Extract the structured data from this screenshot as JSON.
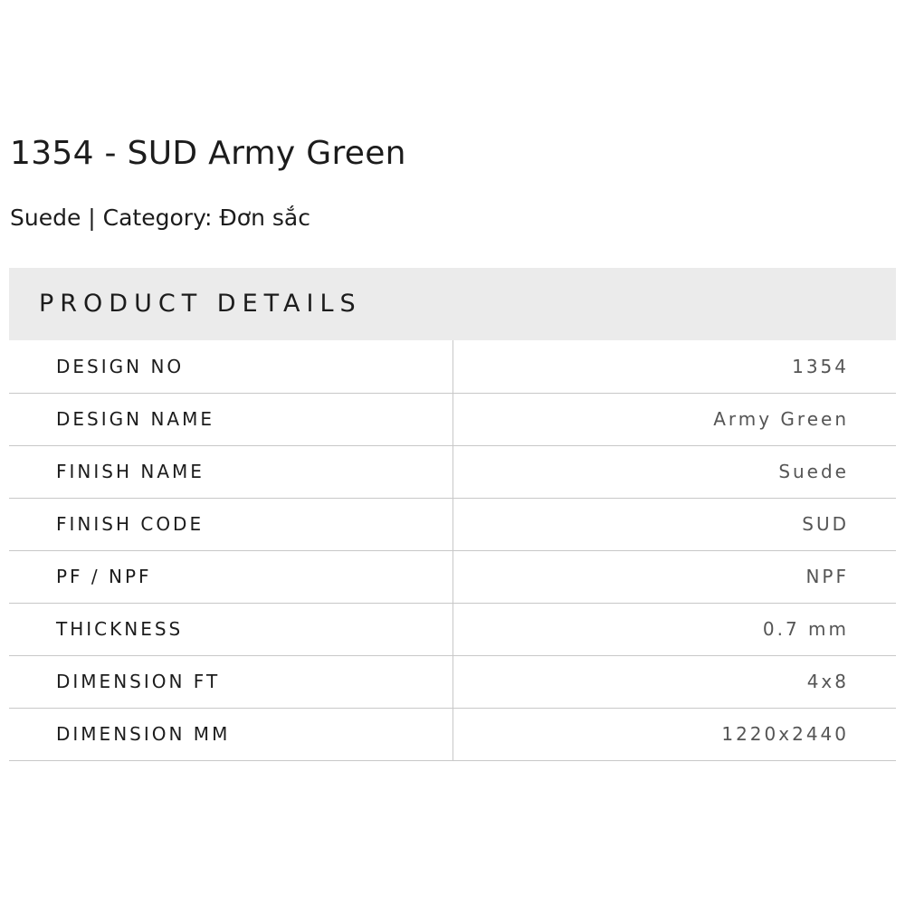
{
  "product": {
    "title": "1354 - SUD Army Green",
    "subtitle": "Suede | Category: Đơn sắc"
  },
  "details": {
    "heading": "PRODUCT DETAILS",
    "rows": [
      {
        "label": "DESIGN NO",
        "value": "1354"
      },
      {
        "label": "DESIGN NAME",
        "value": "Army Green"
      },
      {
        "label": "FINISH NAME",
        "value": "Suede"
      },
      {
        "label": "FINISH CODE",
        "value": "SUD"
      },
      {
        "label": "PF / NPF",
        "value": "NPF"
      },
      {
        "label": "THICKNESS",
        "value": "0.7 mm"
      },
      {
        "label": "DIMENSION FT",
        "value": "4x8"
      },
      {
        "label": "DIMENSION MM",
        "value": "1220x2440"
      }
    ]
  },
  "colors": {
    "header_background": "#ebebeb",
    "divider": "#c8c8c8",
    "label_text": "#1c1c1c",
    "value_text": "#555555"
  }
}
